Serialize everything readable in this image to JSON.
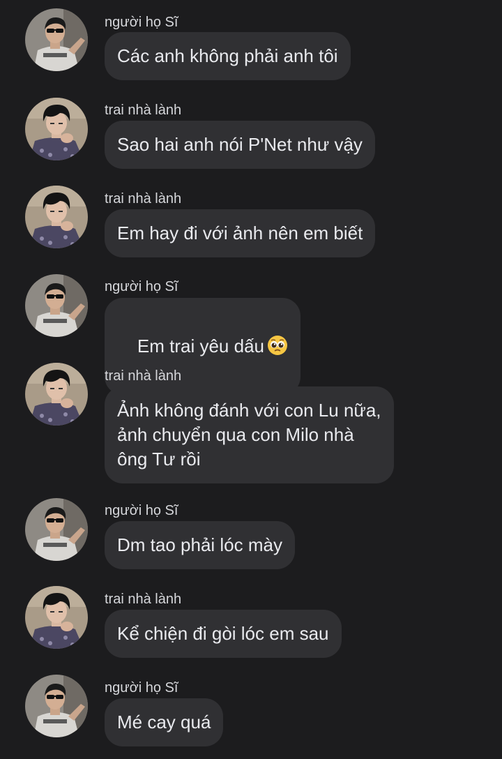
{
  "messages": [
    {
      "sender": "người họ Sĩ",
      "text": "Các anh không phải anh tôi",
      "avatar": "sunglasses-man-avatar"
    },
    {
      "sender": "trai nhà lành",
      "text": "Sao hai anh nói P'Net như vậy",
      "avatar": "dark-hair-man-avatar"
    },
    {
      "sender": "trai nhà lành",
      "text": "Em hay đi với ảnh nên em biết",
      "avatar": "dark-hair-man-avatar"
    },
    {
      "sender": "người họ Sĩ",
      "text": "Em trai yêu dấu",
      "emoji": "pleading-face-emoji",
      "avatar": "sunglasses-man-avatar"
    },
    {
      "sender": "trai nhà lành",
      "text": "Ảnh không đánh với con Lu nữa,\nảnh chuyển qua con Milo nhà\nông Tư rồi",
      "avatar": "dark-hair-man-avatar"
    },
    {
      "sender": "người họ Sĩ",
      "text": "Dm tao phải lóc mày",
      "avatar": "sunglasses-man-avatar"
    },
    {
      "sender": "trai nhà lành",
      "text": "Kể chiện đi gòi lóc em sau",
      "avatar": "dark-hair-man-avatar"
    },
    {
      "sender": "người họ Sĩ",
      "text": "Mé cay quá",
      "avatar": "sunglasses-man-avatar"
    }
  ],
  "colors": {
    "background": "#1c1c1e",
    "bubble": "#303033",
    "text": "#e9eaee",
    "sender": "#d6d7db"
  }
}
